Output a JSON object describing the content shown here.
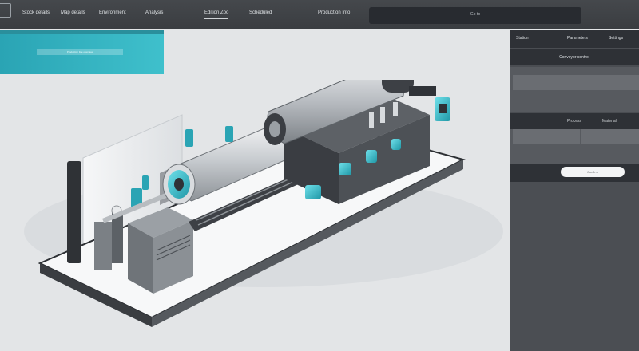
{
  "nav": {
    "items": [
      {
        "label": "Stock details"
      },
      {
        "label": "Map details"
      },
      {
        "label": "Environment"
      },
      {
        "label": "Analysis"
      },
      {
        "label": "Edition Zoo"
      },
      {
        "label": "Scheduled"
      },
      {
        "label": "Production Info"
      }
    ],
    "search": {
      "label": "Go to"
    }
  },
  "banner": {
    "field": "Production line overview"
  },
  "illustration": {
    "subject": "isometric industrial production line machine",
    "colors": {
      "accent": "#33bccc",
      "metal": "#c9cdd1",
      "dark": "#3b3e42",
      "platform": "#f5f6f7"
    }
  },
  "panel": {
    "tabs": [
      {
        "label": "Station"
      },
      {
        "label": "Parameters"
      },
      {
        "label": "Settings"
      }
    ],
    "subheader": "Conveyor control",
    "section_labels": [
      {
        "label": "Process"
      },
      {
        "label": "Material"
      }
    ],
    "button": "Confirm"
  },
  "colors": {
    "nav_bg": "#3a3d41",
    "accent": "#33bccc",
    "panel_bg": "#4a4d52",
    "page_bg": "#e3e5e7"
  }
}
